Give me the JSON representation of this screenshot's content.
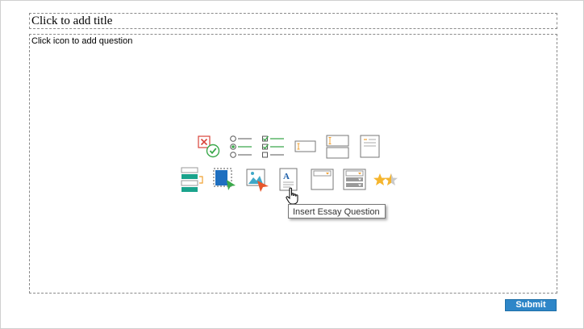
{
  "form": {
    "title_placeholder": "Click to add title",
    "question_hint": "Click icon to add question",
    "submit_label": "Submit"
  },
  "toolbar": {
    "row1": [
      {
        "icon": "true-false-icon"
      },
      {
        "icon": "multiple-choice-icon"
      },
      {
        "icon": "multiple-response-icon"
      },
      {
        "icon": "fill-in-blank-icon"
      },
      {
        "icon": "matching-icon"
      },
      {
        "icon": "sequence-icon"
      }
    ],
    "row2": [
      {
        "icon": "word-bank-icon"
      },
      {
        "icon": "click-map-icon"
      },
      {
        "icon": "image-hotspot-icon"
      },
      {
        "icon": "essay-icon"
      },
      {
        "icon": "dropdown-icon"
      },
      {
        "icon": "multi-dropdown-icon"
      },
      {
        "icon": "rating-stars-icon"
      }
    ]
  },
  "tooltip": {
    "text": "Insert Essay Question"
  },
  "colors": {
    "accent": "#2e86c8",
    "green": "#3aa84a",
    "red": "#d9433a",
    "orange": "#f0a030",
    "teal": "#1aa38c"
  }
}
